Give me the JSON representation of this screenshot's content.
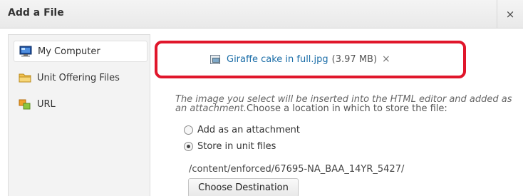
{
  "dialog": {
    "title": "Add a File",
    "close_icon": "×"
  },
  "sidebar": {
    "items": [
      {
        "label": "My Computer",
        "icon": "computer-icon",
        "active": true
      },
      {
        "label": "Unit Offering Files",
        "icon": "folder-icon",
        "active": false
      },
      {
        "label": "URL",
        "icon": "url-icon",
        "active": false
      }
    ]
  },
  "file": {
    "name": "Giraffe cake in full.jpg",
    "size": "(3.97 MB)",
    "remove_icon": "×",
    "icon": "image-file-icon"
  },
  "description": {
    "italic": "The image you select will be inserted into the HTML editor and added as an attachment.",
    "normal": "Choose a location in which to store the file:"
  },
  "options": [
    {
      "label": "Add as an attachment",
      "checked": false
    },
    {
      "label": "Store in unit files",
      "checked": true
    }
  ],
  "destination": {
    "path": "/content/enforced/67695-NA_BAA_14YR_5427/",
    "button_label": "Choose Destination"
  },
  "colors": {
    "highlight": "#e0162b",
    "link": "#1c6ea8"
  }
}
